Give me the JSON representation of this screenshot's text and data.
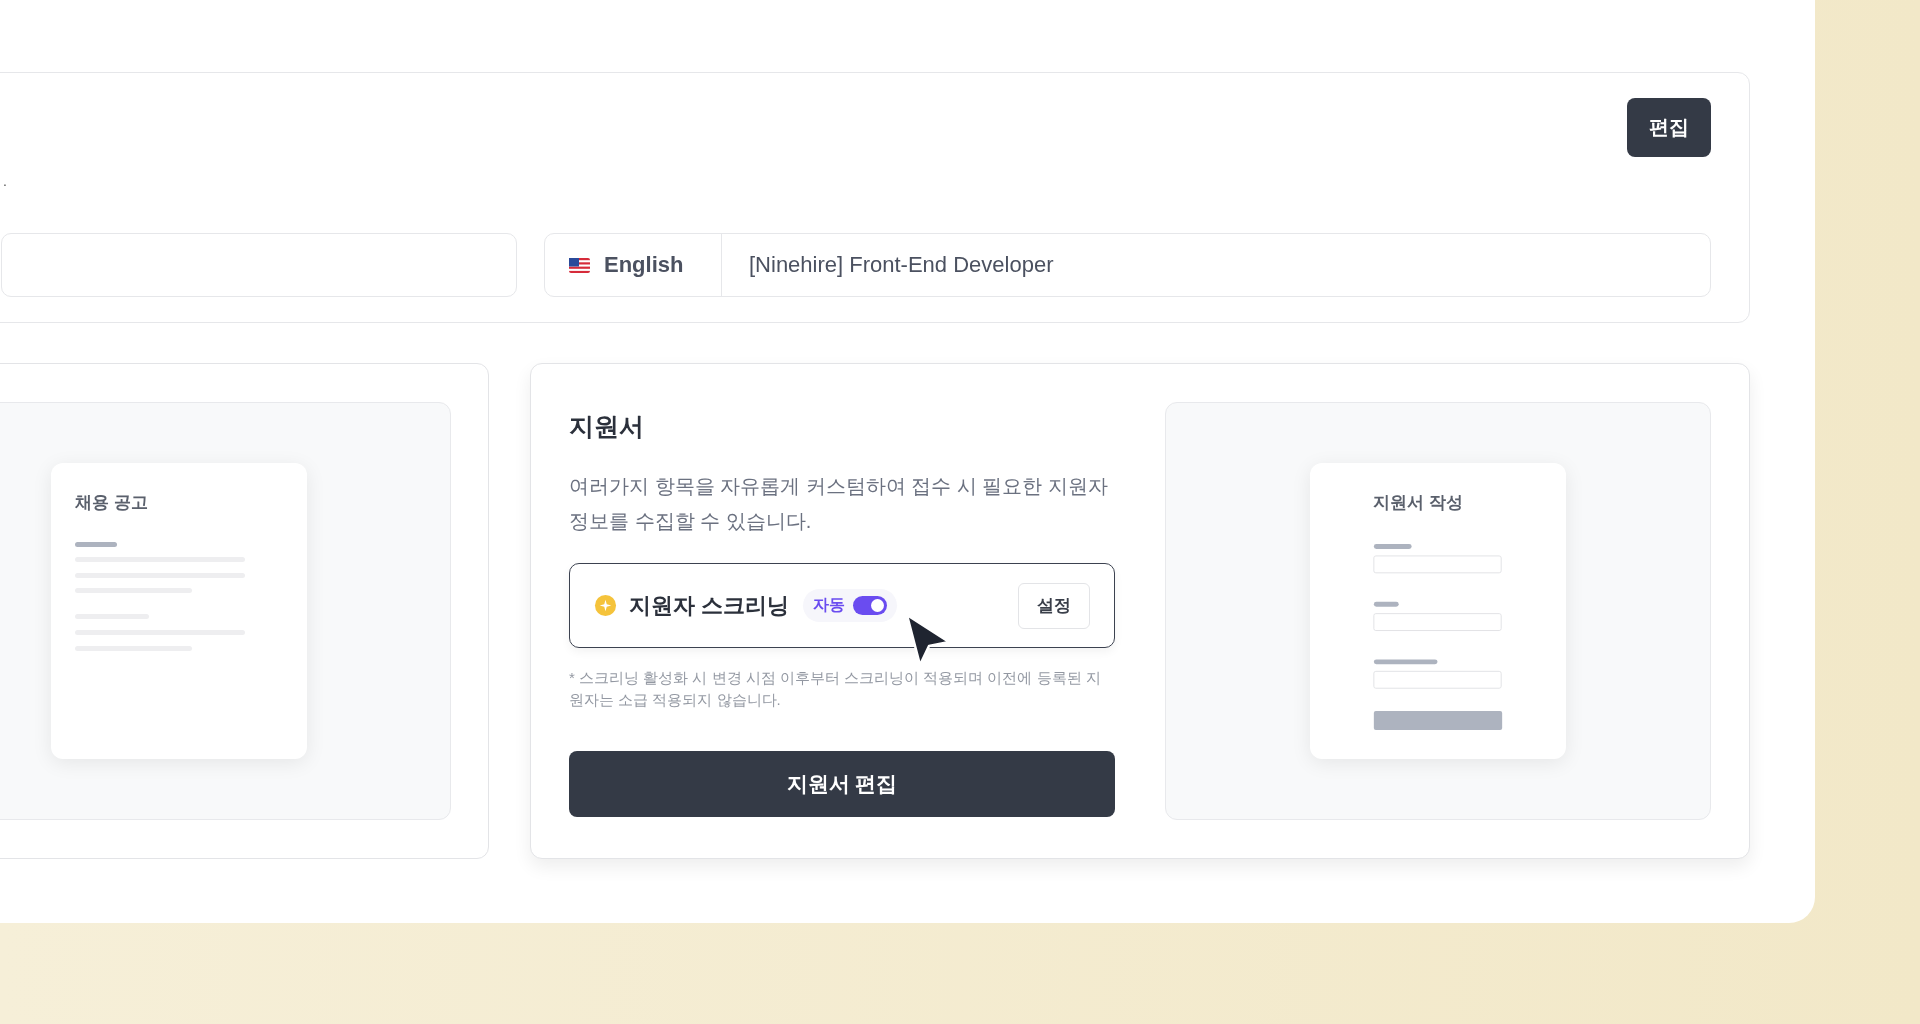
{
  "header": {
    "description_tail": ".",
    "edit_button": "편집"
  },
  "title_field": {
    "language": "English",
    "value": "[Ninehire] Front-End Developer"
  },
  "job_post_preview": {
    "title": "채용 공고"
  },
  "application_form": {
    "title": "지원서",
    "description": "여러가지 항목을 자유롭게 커스텀하여 접수 시 필요한 지원자 정보를 수집할 수 있습니다.",
    "screening": {
      "label": "지원자 스크리닝",
      "mode": "자동",
      "on": true,
      "settings_button": "설정"
    },
    "note": "* 스크리닝 활성화 시 변경 시점 이후부터 스크리닝이 적용되며 이전에 등록된 지원자는 소급 적용되지 않습니다.",
    "edit_button": "지원서 편집",
    "preview": {
      "title": "지원서 작성"
    }
  }
}
